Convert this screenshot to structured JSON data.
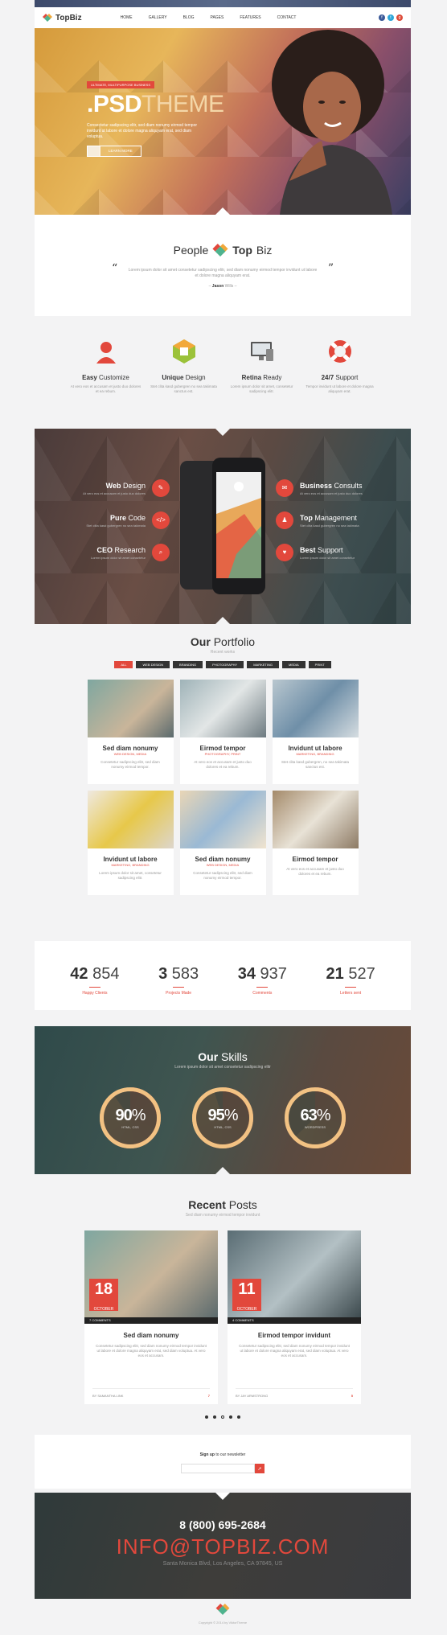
{
  "brand": {
    "name": "TopBiz",
    "name_top": "Top",
    "name_biz": "Biz"
  },
  "nav": {
    "items": [
      "HOME",
      "GALLERY",
      "BLOG",
      "PAGES",
      "FEATURES",
      "CONTACT"
    ]
  },
  "social": [
    "f",
    "t",
    "g"
  ],
  "hero": {
    "tag": "ULTIMATE, MULTIPURPOSE BUSINESS",
    "title_bold": ".PSD",
    "title_light": "THEME",
    "sub": "Consectetur sadipscing elitr, sed diam nonumy eirmod tempor invidunt ut labore et dolore magna aliquyam erat, sed diam voluptua.",
    "button": "LEARN MORE"
  },
  "people": {
    "title_a": "People",
    "title_top": "Top",
    "title_biz": "Biz",
    "quote": "Lorem ipsum dolor sit amet consetetur sadipscing elitr, sed diam nonumy eirmod tempor invidunt ut labore et dolore magna aliquyam erat.",
    "author": "Jason",
    "author_role": "Wills"
  },
  "features": [
    {
      "bold": "Easy",
      "rest": " Customize",
      "desc": "At vero eos et accusam et justo duo dolores et ea rebum."
    },
    {
      "bold": "Unique",
      "rest": " Design",
      "desc": "Stet clita kasd gubergren no sea takimata sanctus est."
    },
    {
      "bold": "Retina",
      "rest": " Ready",
      "desc": "Lorem ipsum dolor sit amet, consetetur sadipscing elitr."
    },
    {
      "bold": "24/7",
      "rest": " Support",
      "desc": "Tempor invidunt ut labore et dolore magna aliquyam erat."
    }
  ],
  "services_left": [
    {
      "bold": "Web",
      "rest": " Design",
      "desc": "At vero eos et accusam et justo duo dolores",
      "icon": "✎"
    },
    {
      "bold": "Pure",
      "rest": " Code",
      "desc": "Stet clita kasd gubergren no sea takimata",
      "icon": "</>"
    },
    {
      "bold": "CEO",
      "rest": " Research",
      "desc": "Lorem ipsum dolor sit amet consetetur",
      "icon": "⌕"
    }
  ],
  "services_right": [
    {
      "bold": "Business",
      "rest": " Consults",
      "desc": "At vero eos et accusam et justo duo dolores",
      "icon": "✉"
    },
    {
      "bold": "Top",
      "rest": " Management",
      "desc": "Stet clita kasd gubergren no sea takimata",
      "icon": "♟"
    },
    {
      "bold": "Best",
      "rest": " Support",
      "desc": "Lorem ipsum dolor sit amet consetetur",
      "icon": "♥"
    }
  ],
  "portfolio": {
    "title_bold": "Our",
    "title_light": " Portfolio",
    "sub": "Recent works",
    "filters": [
      "ALL",
      "WEB DESIGN",
      "BRANDING",
      "PHOTOGRAPHY",
      "MARKETING",
      "MEDIA",
      "PRINT"
    ],
    "items": [
      {
        "title": "Sed diam nonumy",
        "cat": "WEB DESIGN, MEDIA",
        "desc": "Consetetur sadipscing elitr, sed diam nonumy eirmod tempor."
      },
      {
        "title": "Eirmod tempor",
        "cat": "PHOTOGRAPHY, PRINT",
        "desc": "At vero eos et accusam et justo duo dolores et ea rebum."
      },
      {
        "title": "Invidunt ut labore",
        "cat": "MARKETING, BRANDING",
        "desc": "Stet clita kasd gubergren, no sea takimata sanctus est."
      },
      {
        "title": "Invidunt ut labore",
        "cat": "MARKETING, BRANDING",
        "desc": "Lorem ipsum dolor sit amet, consetetur sadipscing elitr."
      },
      {
        "title": "Sed diam nonumy",
        "cat": "WEB DESIGN, MEDIA",
        "desc": "Consetetur sadipscing elitr, sed diam nonumy eirmod tempor."
      },
      {
        "title": "Eirmod tempor",
        "cat": "",
        "desc": "At vero eos et accusam et justo duo dolores et ea rebum."
      }
    ]
  },
  "counters": [
    {
      "big": "42",
      "small": " 854",
      "label": "Happy Clients"
    },
    {
      "big": "3",
      "small": " 583",
      "label": "Projects Made"
    },
    {
      "big": "34",
      "small": " 937",
      "label": "Comments"
    },
    {
      "big": "21",
      "small": " 527",
      "label": "Letters sent"
    }
  ],
  "skills": {
    "title_bold": "Our",
    "title_light": " Skills",
    "sub": "Lorem ipsum dolor sit amet consetetur sadipscing elitr",
    "items": [
      {
        "num": "90",
        "pct": "%",
        "label": "HTML, CSS",
        "value": 90
      },
      {
        "num": "95",
        "pct": "%",
        "label": "HTML, CSS",
        "value": 95
      },
      {
        "num": "63",
        "pct": "%",
        "label": "WORDPRESS",
        "value": 63
      }
    ]
  },
  "posts": {
    "title_bold": "Recent",
    "title_light": " Posts",
    "sub": "Sed diam nonumy eirmod tempor invidunt",
    "items": [
      {
        "day": "18",
        "month": "OCTOBER",
        "comments": "7 COMMENTS",
        "title": "Sed diam nonumy",
        "desc": "Consetetur sadipscing elitr, sed diam nonumy eirmod tempor invidunt ut labore et dolore magna aliquyam erat, sed diam voluptua. At vero eos et accusam.",
        "author": "BY SAMANTHA LINK",
        "likes": "7"
      },
      {
        "day": "11",
        "month": "OCTOBER",
        "comments": "4 COMMENTS",
        "title": "Eirmod tempor invidunt",
        "desc": "Consetetur sadipscing elitr, sed diam nonumy eirmod tempor invidunt ut labore et dolore magna aliquyam erat, sed diam voluptua. At vero eos et accusam.",
        "author": "BY JAY ARMSTRONG",
        "likes": "5"
      }
    ]
  },
  "newsletter": {
    "bold": "Sign up",
    "rest": " to our newsletter",
    "placeholder": "",
    "button_icon": "➚"
  },
  "contact": {
    "phone": "8 (800) 695-2684",
    "email": "INFO@TOPBIZ.COM",
    "address": "Santa Monica Blvd, Los Angeles, CA 97845, US"
  },
  "footer": {
    "copyright": "Copyright © 2014 by ViktorTheme"
  },
  "colors": {
    "accent": "#e2483c",
    "dark": "#333333"
  }
}
